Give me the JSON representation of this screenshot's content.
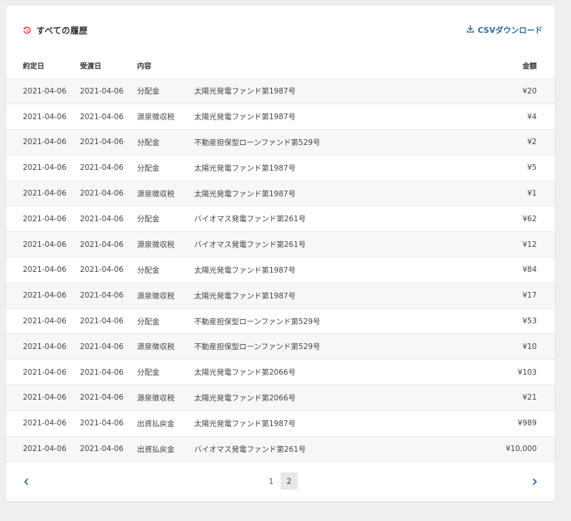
{
  "header": {
    "title": "すべての履歴",
    "csv_label": "CSVダウンロード",
    "history_icon_color": "#e0313b",
    "link_color": "#2b6a9f"
  },
  "table": {
    "columns": [
      "約定日",
      "受渡日",
      "内容",
      "",
      "金額"
    ],
    "rows": [
      [
        "2021-04-06",
        "2021-04-06",
        "分配金",
        "太陽光発電ファンド第1987号",
        "¥20"
      ],
      [
        "2021-04-06",
        "2021-04-06",
        "源泉徴収税",
        "太陽光発電ファンド第1987号",
        "¥4"
      ],
      [
        "2021-04-06",
        "2021-04-06",
        "分配金",
        "不動産担保型ローンファンド第529号",
        "¥2"
      ],
      [
        "2021-04-06",
        "2021-04-06",
        "分配金",
        "太陽光発電ファンド第1987号",
        "¥5"
      ],
      [
        "2021-04-06",
        "2021-04-06",
        "源泉徴収税",
        "太陽光発電ファンド第1987号",
        "¥1"
      ],
      [
        "2021-04-06",
        "2021-04-06",
        "分配金",
        "バイオマス発電ファンド第261号",
        "¥62"
      ],
      [
        "2021-04-06",
        "2021-04-06",
        "源泉徴収税",
        "バイオマス発電ファンド第261号",
        "¥12"
      ],
      [
        "2021-04-06",
        "2021-04-06",
        "分配金",
        "太陽光発電ファンド第1987号",
        "¥84"
      ],
      [
        "2021-04-06",
        "2021-04-06",
        "源泉徴収税",
        "太陽光発電ファンド第1987号",
        "¥17"
      ],
      [
        "2021-04-06",
        "2021-04-06",
        "分配金",
        "不動産担保型ローンファンド第529号",
        "¥53"
      ],
      [
        "2021-04-06",
        "2021-04-06",
        "源泉徴収税",
        "不動産担保型ローンファンド第529号",
        "¥10"
      ],
      [
        "2021-04-06",
        "2021-04-06",
        "分配金",
        "太陽光発電ファンド第2066号",
        "¥103"
      ],
      [
        "2021-04-06",
        "2021-04-06",
        "源泉徴収税",
        "太陽光発電ファンド第2066号",
        "¥21"
      ],
      [
        "2021-04-06",
        "2021-04-06",
        "出資払戻金",
        "太陽光発電ファンド第1987号",
        "¥989"
      ],
      [
        "2021-04-06",
        "2021-04-06",
        "出資払戻金",
        "バイオマス発電ファンド第261号",
        "¥10,000"
      ]
    ]
  },
  "pagination": {
    "pages": [
      "1",
      "2"
    ],
    "current": "2",
    "prev_icon": "chevron-left-icon",
    "next_icon": "chevron-right-icon"
  }
}
